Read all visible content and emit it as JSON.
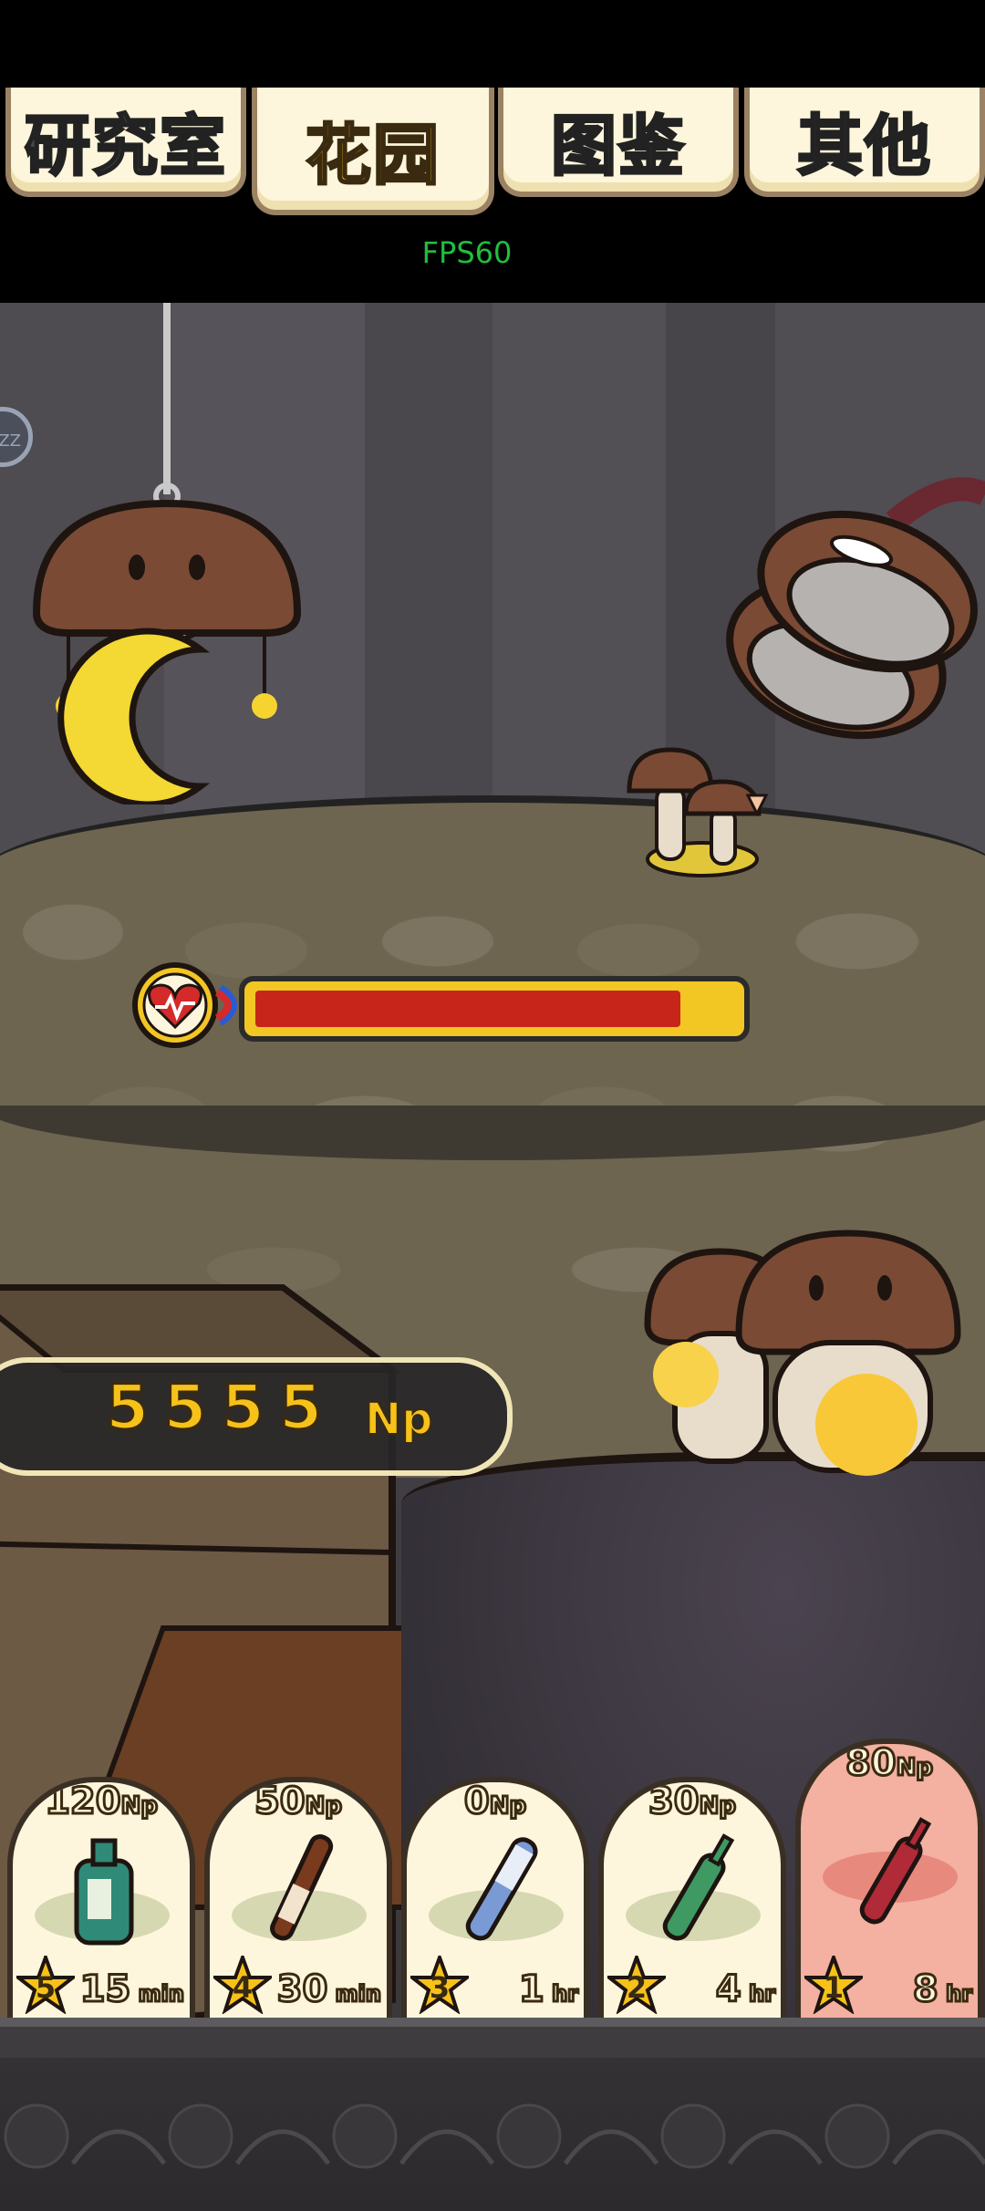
{
  "tabs": [
    {
      "label": "研究室"
    },
    {
      "label": "花园"
    },
    {
      "label": "图鉴"
    },
    {
      "label": "其他"
    }
  ],
  "fps_label": "FPS60",
  "side_button_label": "ZZ",
  "status_bar": {
    "fill_fraction": 0.9
  },
  "currency": {
    "value": "5555",
    "unit": "Np"
  },
  "items": [
    {
      "price": "120",
      "price_unit": "Np",
      "rank": "5",
      "time": "15",
      "time_unit": "min",
      "icon": "green-perfume-bottle-icon"
    },
    {
      "price": "50",
      "price_unit": "Np",
      "rank": "4",
      "time": "30",
      "time_unit": "min",
      "icon": "brown-bottle-icon"
    },
    {
      "price": "0",
      "price_unit": "Np",
      "rank": "3",
      "time": "1",
      "time_unit": "hr",
      "icon": "blue-vial-icon"
    },
    {
      "price": "30",
      "price_unit": "Np",
      "rank": "2",
      "time": "4",
      "time_unit": "hr",
      "icon": "green-ampoule-icon"
    },
    {
      "price": "80",
      "price_unit": "Np",
      "rank": "1",
      "time": "8",
      "time_unit": "hr",
      "icon": "red-ampoule-icon"
    }
  ],
  "colors": {
    "accent": "#f6c21a",
    "bar_fill": "#c7251a",
    "card_bg": "#fdf6dc",
    "card_selected": "#f4b0a0"
  }
}
